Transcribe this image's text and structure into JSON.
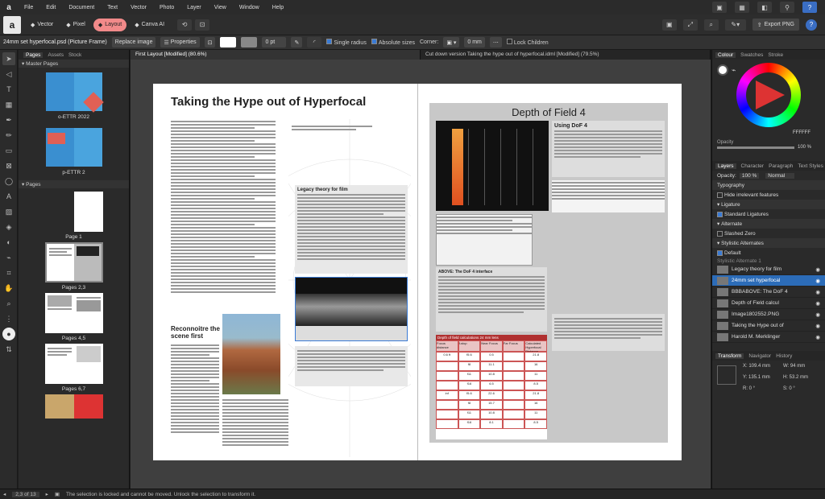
{
  "app": {
    "menus": [
      "File",
      "Edit",
      "Document",
      "Text",
      "Vector",
      "Photo",
      "Layer",
      "View",
      "Window",
      "Help"
    ]
  },
  "personas": [
    {
      "label": "Vector",
      "icon": "vector-icon",
      "active": false
    },
    {
      "label": "Pixel",
      "icon": "pixel-icon",
      "active": false
    },
    {
      "label": "Layout",
      "icon": "layout-icon",
      "active": true
    },
    {
      "label": "Canva AI",
      "icon": "canva-ai-icon",
      "active": false
    }
  ],
  "export_label": "Export PNG",
  "context": {
    "selection": "24mm set hyperfocal.psd (Picture Frame)",
    "replace_image": "Replace image",
    "properties": "Properties",
    "stroke_value": "0 pt",
    "single_radius": "Single radius",
    "absolute_sizes": "Absolute sizes",
    "corner_label": "Corner:",
    "corner_value": "0 mm",
    "lock_children": "Lock Children"
  },
  "left_panel": {
    "tabs": [
      "Pages",
      "Assets",
      "Stock"
    ],
    "master_section": "Master Pages",
    "masters": [
      "o-ETTR 2022",
      "p-ETTR 2"
    ],
    "pages_section": "Pages",
    "pages": [
      "Page 1",
      "Pages 2,3",
      "Pages 4,5",
      "Pages 6,7"
    ]
  },
  "doc_tabs": [
    {
      "label": "First Layout [Modified] (80.6%)",
      "active": true
    },
    {
      "label": "Cut down version Taking the hype out of hyperfocal.idml [Modified] (79.5%)",
      "active": false
    }
  ],
  "spread": {
    "left_title": "Taking the Hype out of Hyperfocal",
    "left_subhead": "Reconnoitre the scene first",
    "sidebar_title": "Legacy theory for film",
    "right_title": "Depth of Field 4",
    "right_sub": "Using DoF 4",
    "above_caption": "ABOVE: The DoF 4 interface",
    "table_title": "Depth of field calculations 24 mm lens",
    "table_headers": [
      "Focus distance",
      "f-stop",
      "Near Focus",
      "Far Focus",
      "Calculated Hyperfocal Distance"
    ],
    "table_rows": [
      [
        "0.6 ft",
        "f5.6",
        "0.5",
        "",
        "21.8"
      ],
      [
        "",
        "f8",
        "11.1",
        "",
        "16"
      ],
      [
        "",
        "f11",
        "10.8",
        "",
        "11"
      ],
      [
        "",
        "f16",
        "6.5",
        "",
        "8.5"
      ],
      [
        "inf",
        "f5.6",
        "22.6",
        "",
        "21.8"
      ],
      [
        "",
        "f8",
        "15.7",
        "",
        "16"
      ],
      [
        "",
        "f11",
        "10.8",
        "",
        "11"
      ],
      [
        "",
        "f16",
        "8.1",
        "",
        "8.5"
      ]
    ]
  },
  "right_panel": {
    "top_tabs": [
      "Colour",
      "Swatches",
      "Stroke"
    ],
    "hex": "FFFFFF",
    "opacity_label": "Opacity",
    "opacity_value": "100 %",
    "layer_tabs": [
      "Layers",
      "Character",
      "Paragraph",
      "Text Styles"
    ],
    "opacity_row": "Opacity:",
    "opacity_row_value": "100 %",
    "blend": "Normal",
    "typography": "Typography",
    "hide_irrelevant": "Hide irrelevant features",
    "ligature": "Ligature",
    "standard_ligatures": "Standard Ligatures",
    "alternate": "Alternate",
    "slashed_zero": "Slashed Zero",
    "stylistic_alternates": "Stylistic Alternates",
    "default": "Default",
    "stylistic_alt1": "Stylistic Alternate 1",
    "layers": [
      {
        "name": "Legacy theory for film",
        "selected": false
      },
      {
        "name": "24mm set hyperfocal",
        "selected": true
      },
      {
        "name": "BBBABOVE: The DoF 4",
        "selected": false
      },
      {
        "name": "Depth of Field calcul",
        "selected": false
      },
      {
        "name": "Image1802552.PNG",
        "selected": false
      },
      {
        "name": "Taking the Hype out of",
        "selected": false
      },
      {
        "name": "Harold M. Merklinger",
        "selected": false
      }
    ],
    "bottom_tabs": [
      "Transform",
      "Navigator",
      "History"
    ],
    "transform": {
      "x": "109.4 mm",
      "y": "135.1 mm",
      "w": "94 mm",
      "h": "53.2 mm",
      "r": "0 °",
      "s": "0 °"
    }
  },
  "status": {
    "page": "2,3 of 13",
    "message": "The selection is locked and cannot be moved. Unlock the selection to transform it."
  }
}
